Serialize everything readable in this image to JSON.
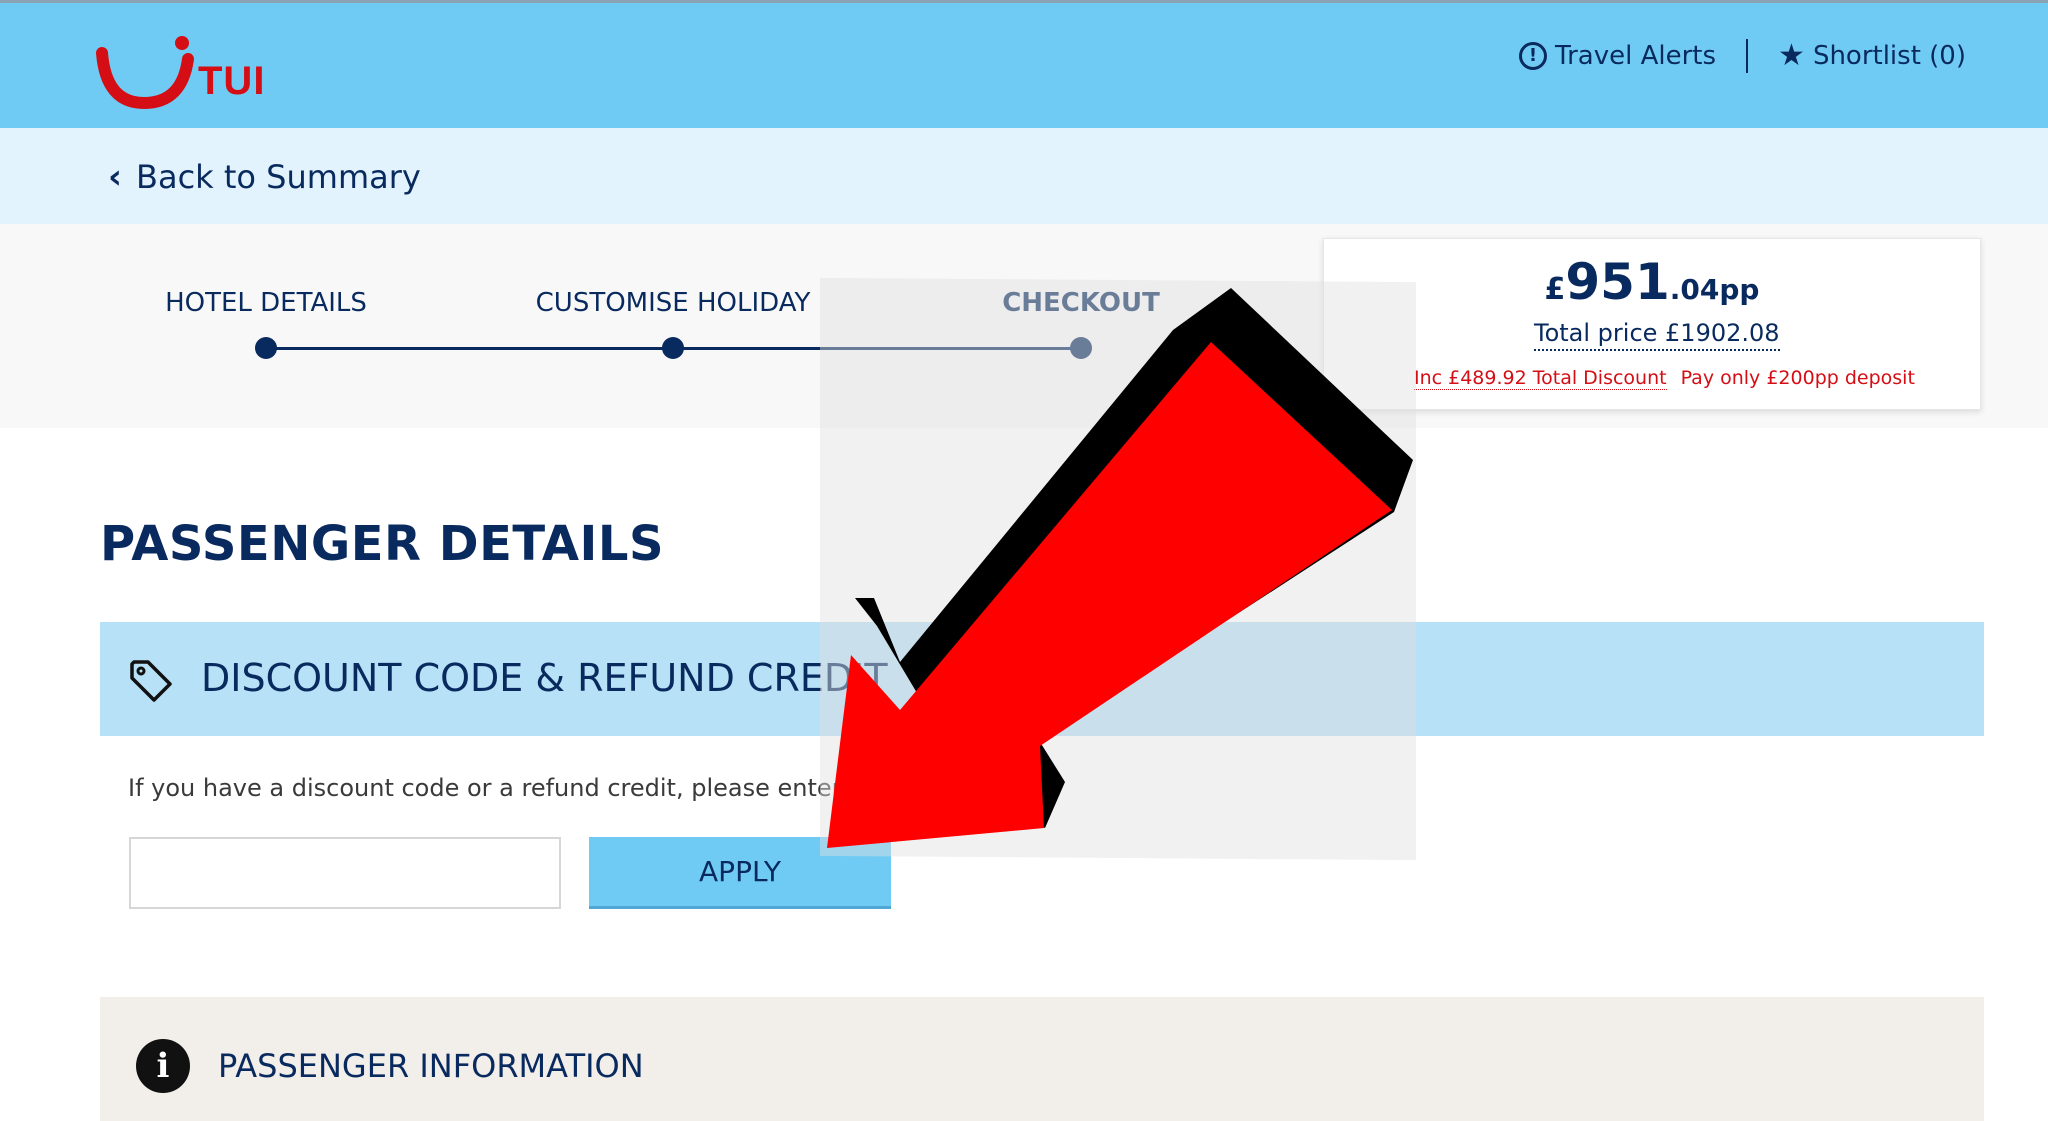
{
  "header": {
    "logo_text": "TUI",
    "travel_alerts_label": "Travel Alerts",
    "shortlist_label": "Shortlist (0)"
  },
  "nav": {
    "back_label": "Back to Summary"
  },
  "progress": {
    "steps": [
      "HOTEL DETAILS",
      "CUSTOMISE HOLIDAY",
      "CHECKOUT"
    ],
    "current_step": "CHECKOUT"
  },
  "price": {
    "currency": "£",
    "whole": "951",
    "fraction": ".04",
    "unit": "pp",
    "total_label": "Total price £1902.08",
    "discount_label": "Inc £489.92 Total Discount",
    "deposit_label": "Pay only £200pp deposit"
  },
  "passenger": {
    "title": "PASSENGER DETAILS"
  },
  "discount": {
    "title": "DISCOUNT CODE & REFUND CREDIT",
    "hint": "If you have a discount code or a refund credit, please enter it he",
    "input_value": "",
    "apply_label": "APPLY"
  },
  "passenger_info": {
    "title": "PASSENGER INFORMATION"
  },
  "colors": {
    "header_bg": "#70cbf4",
    "back_bar_bg": "#e2f3fd",
    "brand_navy": "#092a5e",
    "brand_red": "#d40e14",
    "discount_bar_bg": "#b7e1f6",
    "passenger_info_bg": "#f2eeea",
    "overlay_arrow": "#ff0000"
  },
  "icons": [
    "tui-smile-logo",
    "alert-circle-icon",
    "star-icon",
    "chevron-left-icon",
    "tag-icon",
    "info-icon",
    "red-arrow-overlay"
  ]
}
